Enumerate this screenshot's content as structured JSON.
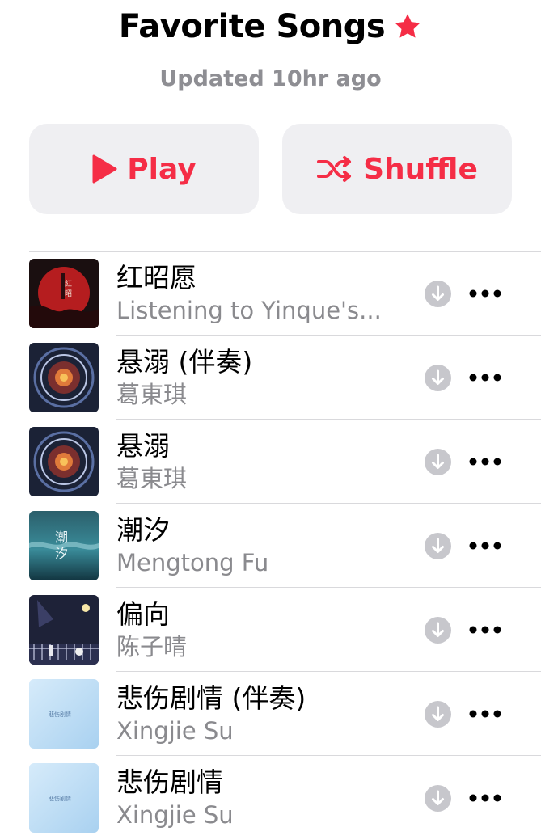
{
  "header": {
    "title": "Favorite Songs",
    "subtitle": "Updated 10hr ago"
  },
  "actions": {
    "play_label": "Play",
    "shuffle_label": "Shuffle"
  },
  "colors": {
    "accent": "#f52d46",
    "secondary_text": "#8a8a8e",
    "button_bg": "#efeff2"
  },
  "icons": {
    "favorite": "star-icon",
    "play": "play-icon",
    "shuffle": "shuffle-icon",
    "download": "download-icon",
    "more": "more-icon"
  },
  "songs": [
    {
      "title": "红昭愿",
      "artist": "Listening to Yinque's..."
    },
    {
      "title": "悬溺 (伴奏)",
      "artist": "葛東琪"
    },
    {
      "title": "悬溺",
      "artist": "葛東琪"
    },
    {
      "title": "潮汐",
      "artist": "Mengtong Fu"
    },
    {
      "title": "偏向",
      "artist": "陈子晴"
    },
    {
      "title": "悲伤剧情 (伴奏)",
      "artist": "Xingjie Su"
    },
    {
      "title": "悲伤剧情",
      "artist": "Xingjie Su"
    }
  ]
}
